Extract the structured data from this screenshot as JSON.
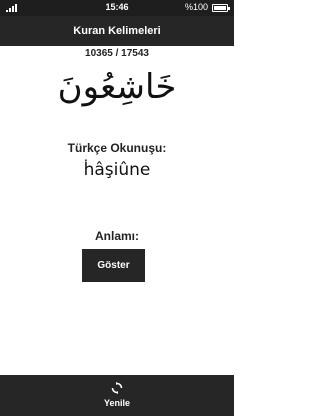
{
  "status_bar": {
    "time": "15:46",
    "battery_text": "%100",
    "signal_icon": "signal-bars-icon",
    "battery_icon": "battery-full-icon"
  },
  "header": {
    "title": "Kuran Kelimeleri"
  },
  "main": {
    "counter": "10365 / 17543",
    "arabic_word": "خَاشِعُونَ",
    "reading_label": "Türkçe Okunuşu:",
    "reading_value": "ḣâşiûne",
    "meaning_label": "Anlamı:",
    "show_button_label": "Göster"
  },
  "bottom_bar": {
    "refresh_label": "Yenile",
    "refresh_icon": "refresh-icon"
  },
  "colors": {
    "bar_background": "#262626",
    "text": "#222222",
    "background": "#ffffff"
  }
}
